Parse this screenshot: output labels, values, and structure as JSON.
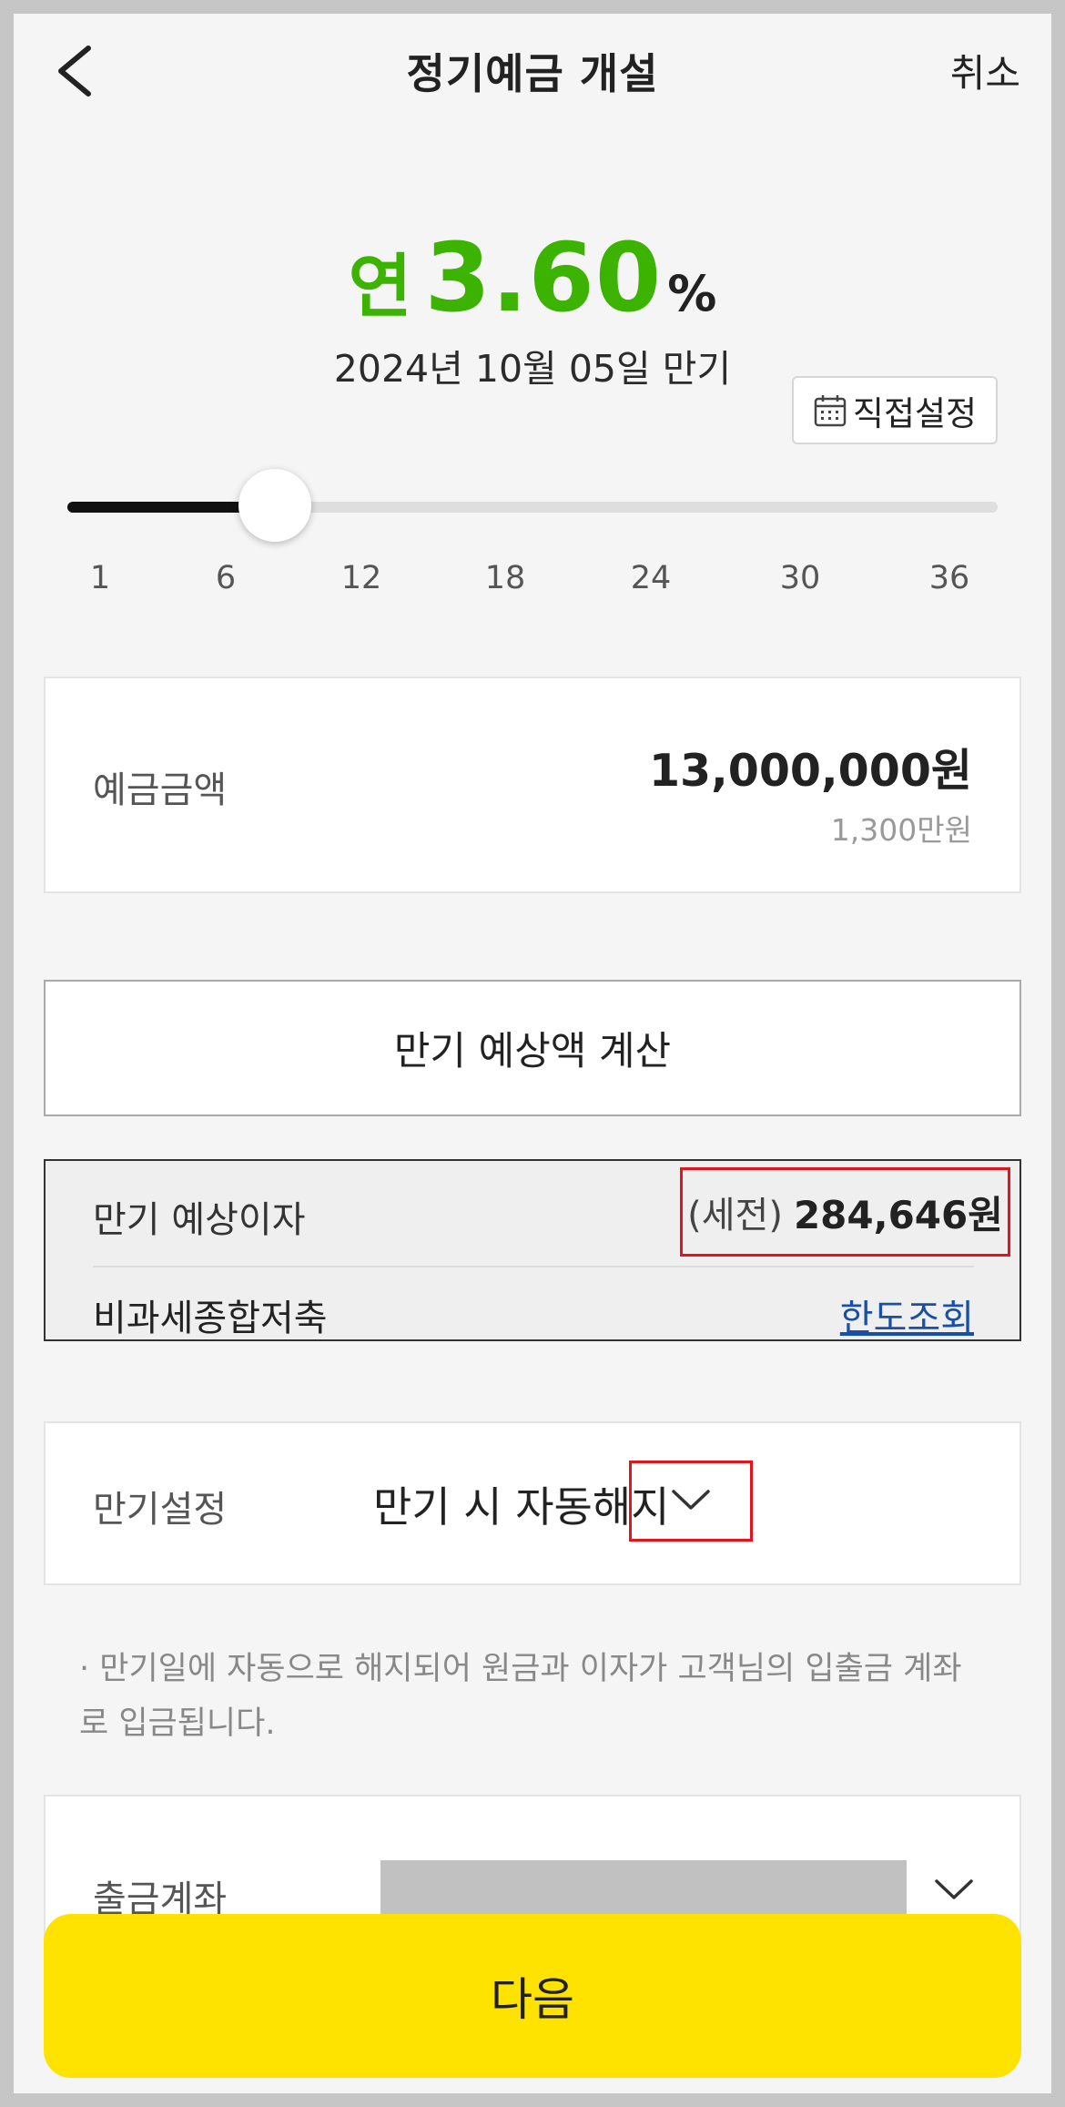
{
  "header": {
    "title": "정기예금 개설",
    "cancel_label": "취소"
  },
  "rate": {
    "prefix": "연",
    "value": "3.60",
    "unit": "%",
    "maturity_text": "2024년 10월 05일 만기"
  },
  "direct_setting": {
    "label": "직접설정"
  },
  "term_slider": {
    "selected_months": 8,
    "min": 1,
    "max": 36,
    "ticks": [
      "1",
      "6",
      "12",
      "18",
      "24",
      "30",
      "36"
    ]
  },
  "deposit": {
    "label": "예금금액",
    "amount": "13,000,000원",
    "amount_korean": "1,300만원"
  },
  "calc_button": {
    "label": "만기 예상액 계산"
  },
  "interest": {
    "label": "만기 예상이자",
    "prefix": "(세전)",
    "value": "284,646원",
    "tax_free_label": "비과세종합저축",
    "limit_link": "한도조회"
  },
  "maturity_setting": {
    "label": "만기설정",
    "value": "만기 시 자동해지"
  },
  "note": "· 만기일에 자동으로 해지되어 원금과 이자가 고객님의 입출금 계좌로 입금됩니다.",
  "withdraw_account": {
    "label": "출금계좌"
  },
  "next_button": {
    "label": "다음"
  },
  "colors": {
    "rate_green": "#3bb300",
    "button_yellow": "#ffe300",
    "highlight_red": "#e3141d",
    "link_blue": "#1a4fa8"
  }
}
